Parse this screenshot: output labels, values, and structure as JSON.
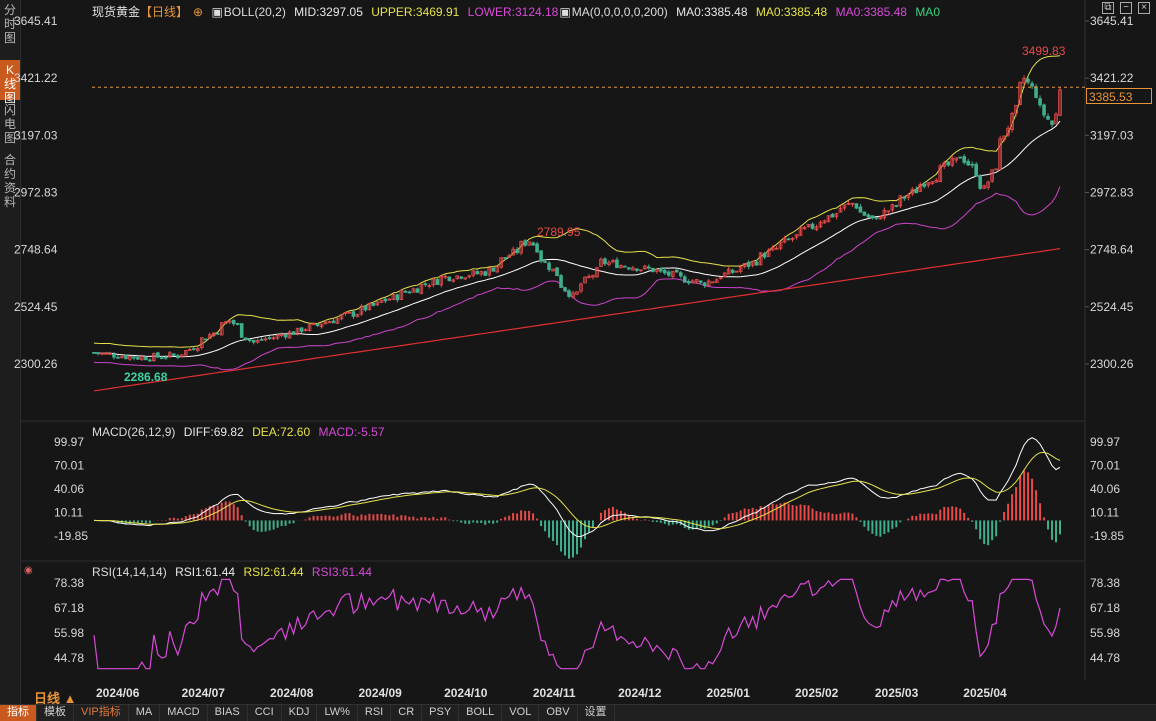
{
  "sidebar": {
    "tabs": [
      {
        "label": "分时图",
        "active": false
      },
      {
        "label": "K线图",
        "active": true
      },
      {
        "label": "闪电图",
        "active": false
      },
      {
        "label": "合约资料",
        "active": false
      }
    ]
  },
  "header": {
    "instrument": "现货黄金",
    "period": "【日线】",
    "boll": "BOLL(20,2)",
    "boll_mid": "MID:3297.05",
    "boll_upper": "UPPER:3469.91",
    "boll_lower": "LOWER:3124.18",
    "ma": "MA(0,0,0,0,0,200)",
    "ma_v1": "MA0:3385.48",
    "ma_v2": "MA0:3385.48",
    "ma_v3": "MA0:3385.48",
    "ma_v4": "MA0"
  },
  "price_axis": [
    "3645.41",
    "3421.22",
    "3197.03",
    "2972.83",
    "2748.64",
    "2524.45",
    "2300.26"
  ],
  "current_price": "3385.53",
  "annotations": {
    "high": "3499.83",
    "low": "2286.68",
    "mid_high": "2789.95"
  },
  "macd": {
    "title": "MACD(26,12,9)",
    "diff": "DIFF:69.82",
    "dea": "DEA:72.60",
    "macd": "MACD:-5.57",
    "axis": [
      "99.97",
      "70.01",
      "40.06",
      "10.11",
      "-19.85"
    ]
  },
  "rsi": {
    "title": "RSI(14,14,14)",
    "rsi1": "RSI1:61.44",
    "rsi2": "RSI2:61.44",
    "rsi3": "RSI3:61.44",
    "axis": [
      "78.38",
      "67.18",
      "55.98",
      "44.78"
    ]
  },
  "dates": [
    "2024/06",
    "2024/07",
    "2024/08",
    "2024/09",
    "2024/10",
    "2024/11",
    "2024/12",
    "2025/01",
    "2025/02",
    "2025/03",
    "2025/04"
  ],
  "period_label": "日线",
  "bottom_bar": [
    "指标",
    "模板",
    "VIP指标",
    "MA",
    "MACD",
    "BIAS",
    "CCI",
    "KDJ",
    "LW%",
    "RSI",
    "CR",
    "PSY",
    "BOLL",
    "VOL",
    "OBV",
    "设置"
  ],
  "colors": {
    "up": "#e84a4a",
    "down": "#3fae8c",
    "boll_upper": "#e6e24a",
    "boll_mid": "#ffffff",
    "boll_lower": "#cc44cc",
    "ma200": "#e03030",
    "accent": "#c85a1e"
  },
  "chart_data": {
    "type": "candlestick",
    "title": "现货黄金",
    "ylim": [
      2300.26,
      3645.41
    ],
    "anchors": [
      {
        "date": "2024/05/30",
        "close": 2345
      },
      {
        "date": "2024/06/15",
        "close": 2325
      },
      {
        "date": "2024/06/30",
        "close": 2335
      },
      {
        "date": "2024/07/17",
        "close": 2470
      },
      {
        "date": "2024/07/25",
        "close": 2385
      },
      {
        "date": "2024/08/10",
        "close": 2430
      },
      {
        "date": "2024/08/31",
        "close": 2505
      },
      {
        "date": "2024/09/15",
        "close": 2575
      },
      {
        "date": "2024/09/30",
        "close": 2640
      },
      {
        "date": "2024/10/15",
        "close": 2660
      },
      {
        "date": "2024/10/30",
        "close": 2785
      },
      {
        "date": "2024/11/14",
        "close": 2565
      },
      {
        "date": "2024/11/25",
        "close": 2700
      },
      {
        "date": "2024/12/12",
        "close": 2670
      },
      {
        "date": "2024/12/30",
        "close": 2615
      },
      {
        "date": "2025/01/15",
        "close": 2690
      },
      {
        "date": "2025/01/31",
        "close": 2800
      },
      {
        "date": "2025/02/20",
        "close": 2930
      },
      {
        "date": "2025/02/28",
        "close": 2860
      },
      {
        "date": "2025/03/15",
        "close": 2990
      },
      {
        "date": "2025/03/31",
        "close": 3120
      },
      {
        "date": "2025/04/08",
        "close": 2985
      },
      {
        "date": "2025/04/22",
        "close": 3420
      },
      {
        "date": "2025/05/01",
        "close": 3240
      },
      {
        "date": "2025/05/05",
        "close": 3385
      }
    ]
  }
}
